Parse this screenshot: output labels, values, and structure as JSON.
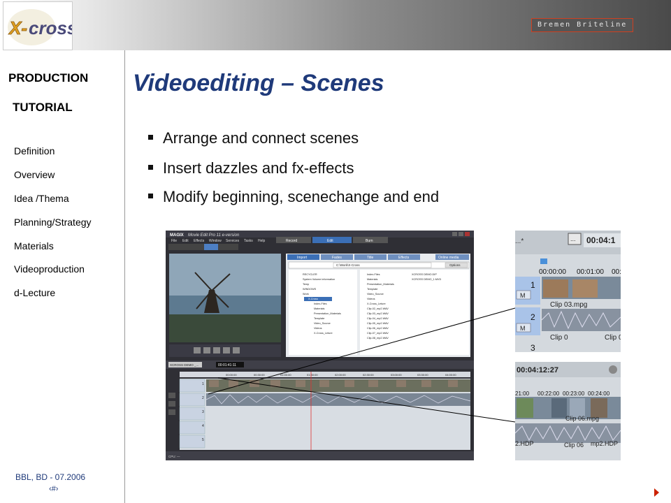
{
  "header": {
    "brand": "Bremen Briteline",
    "logo_text": "X-CROSS"
  },
  "sidebar": {
    "heading_line1": "PRODUCTION",
    "heading_line2": "TUTORIAL",
    "items": [
      "Definition",
      "Overview",
      "Idea /Thema",
      "Planning/Strategy",
      "Materials",
      "Videoproduction",
      "d-Lecture"
    ]
  },
  "slide": {
    "title": "Videoediting – Scenes",
    "bullets": [
      "Arrange and connect scenes",
      "Insert dazzles and fx-effects",
      "Modify beginning, scenechange and end"
    ]
  },
  "footer": {
    "text": "BBL, BD - 07.2006",
    "page": "‹#›"
  },
  "screenshot_main": {
    "app_title": "Movie Edit Pro 11 e-version",
    "app_brand": "MAGIX",
    "menu": [
      "File",
      "Edit",
      "Effects",
      "Window",
      "Services",
      "Tasks",
      "Help"
    ],
    "mode_tabs": [
      "Record",
      "Edit",
      "Burn"
    ],
    "browser_tabs": [
      "Import",
      "Fades",
      "Title",
      "Effects",
      "Online media"
    ],
    "path": "C:\\Work\\X-Cross",
    "options_label": "Options",
    "tree_items": [
      "RECYCLER",
      "System Volume information",
      "Temp",
      "WINDOWS",
      "Work",
      "X-Cross",
      "Index-Files",
      "Materials",
      "Presentation_Materials",
      "Template",
      "Video_Source",
      "Videos",
      "X-Cross_Leture"
    ],
    "file_items": [
      "Index-Files",
      "Materials",
      "Presentation_Materials",
      "Template",
      "Video_Source",
      "Videos",
      "X-Cross_Leture",
      "Clip-02_mp2.WAV",
      "Clip-03_mp2.WAV",
      "Clip-04_mp2.WAV",
      "Clip-05_mp2.WAV",
      "Clip-06_mp2.WAV",
      "Clip-07_mp2.WAV",
      "Clip-08_mp2.WAV"
    ],
    "file_items_2": [
      "XCROSS DEMO.DIP",
      "XCROSS DEMO_1.MVD"
    ],
    "project_name": "XCROSS DEMO _...",
    "timecode": "00:01:41:11",
    "ruler": [
      "00:00:00",
      "00:30:00",
      "01:00:00",
      "01:30:00",
      "02:00:00",
      "02:30:00",
      "03:00:00",
      "03:30:00",
      "04:00:00"
    ],
    "track_numbers": [
      "1",
      "2",
      "3",
      "4",
      "5"
    ],
    "cpu_label": "CPU: —"
  },
  "screenshot_zoom1": {
    "timecode": "00:04:1",
    "ruler": [
      "00:00:00",
      "00:01:00",
      "00:0"
    ],
    "clip_label_1": "Clip 03.mpg",
    "clip_label_2": "Clip 0",
    "clip_label_3": "Clip 0",
    "track_numbers": [
      "1",
      "2",
      "3"
    ]
  },
  "screenshot_zoom2": {
    "timecode": "00:04:12:27",
    "ruler": [
      "21:00",
      "00:22:00",
      "00:23:00",
      "00:24:00"
    ],
    "clip_label_1": "Clip 06.mpg",
    "clip_label_2": "2.HDP",
    "clip_label_3": "Clip 06",
    "clip_label_4": "mp2.HDP"
  },
  "colors": {
    "title": "#1f3a7a",
    "accent_red": "#cc2200",
    "app_blue": "#3b6fb6"
  }
}
